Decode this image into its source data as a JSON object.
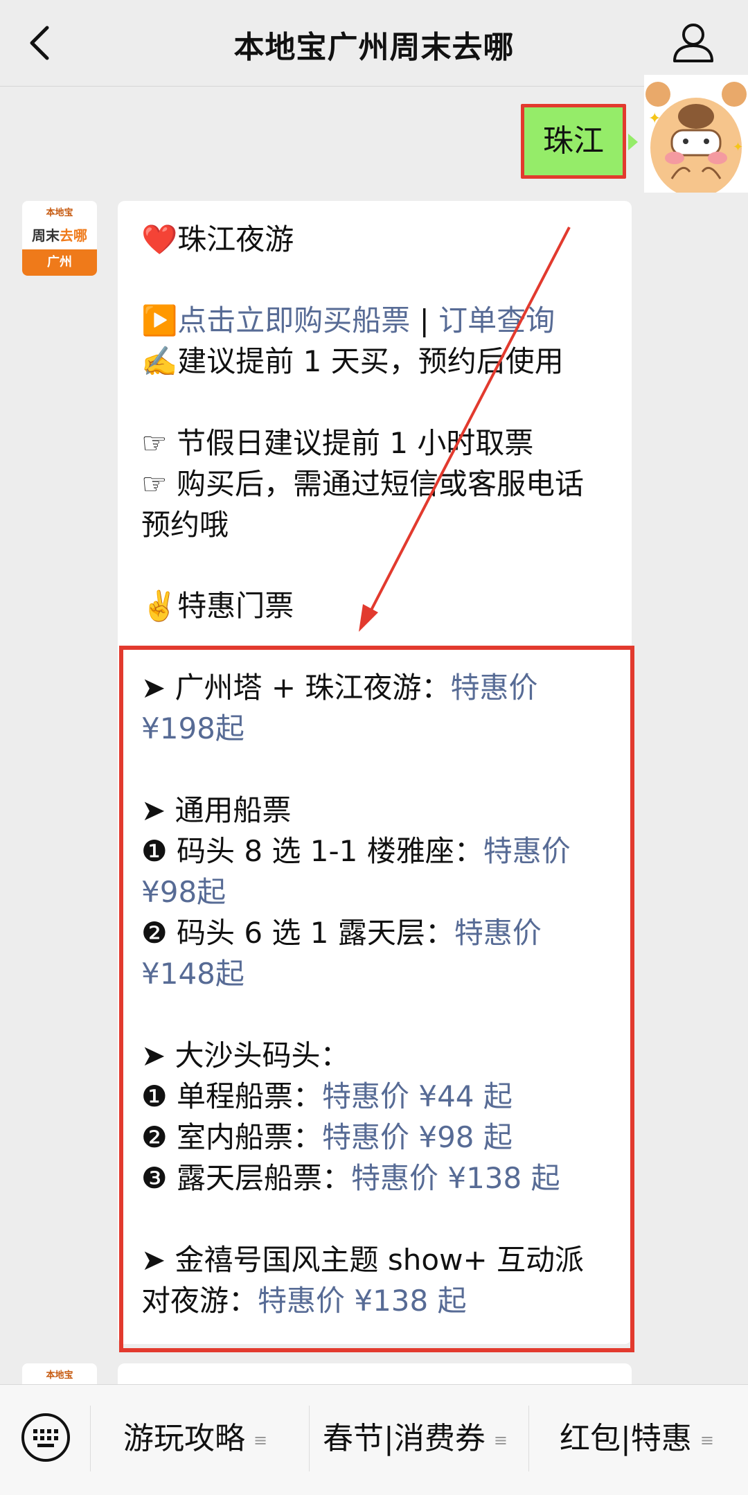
{
  "header": {
    "title": "本地宝广州周末去哪"
  },
  "user_message": {
    "text": "珠江"
  },
  "bot_avatar": {
    "top_text": "本地宝",
    "main_text_a": "周末",
    "main_text_b": "去哪",
    "bottom_text": "广州"
  },
  "message": {
    "line_title": "❤️珠江夜游",
    "buy_prefix": "▶️",
    "buy_link": "点击立即购买船票",
    "separator": " | ",
    "order_link": "订单查询",
    "tip_advance": "✍️建议提前 1 天买，预约后使用",
    "tip_holiday": "☞ 节假日建议提前 1 小时取票",
    "tip_reserve": "☞ 购买后，需通过短信或客服电话预约哦",
    "deal_heading": "✌️特惠门票",
    "item1_label": "➤ 广州塔 + 珠江夜游：",
    "item1_price": "特惠价 ¥198起",
    "item2_heading": "➤ 通用船票",
    "item2_1_label": "❶ 码头 8 选 1-1 楼雅座：",
    "item2_1_price": "特惠价 ¥98起",
    "item2_2_label": "❷ 码头 6 选 1 露天层：",
    "item2_2_price": "特惠价 ¥148起",
    "item3_heading": "➤ 大沙头码头：",
    "item3_1_label": "❶ 单程船票：",
    "item3_1_price": "特惠价 ¥44 起",
    "item3_2_label": "❷ 室内船票：",
    "item3_2_price": "特惠价 ¥98 起",
    "item3_3_label": "❸ 露天层船票：",
    "item3_3_price": "特惠价 ¥138 起",
    "item4_label": "➤ 金禧号国风主题 show+ 互动派对夜游：",
    "item4_price": "特惠价 ¥138 起"
  },
  "bottom_menu": {
    "items": [
      {
        "label": "游玩攻略"
      },
      {
        "label": "春节|消费券"
      },
      {
        "label": "红包|特惠"
      }
    ]
  },
  "colors": {
    "link": "#576b95",
    "user_bubble": "#95ec69",
    "annotation_red": "#e23a2e",
    "brand_orange": "#ef7a1a"
  }
}
